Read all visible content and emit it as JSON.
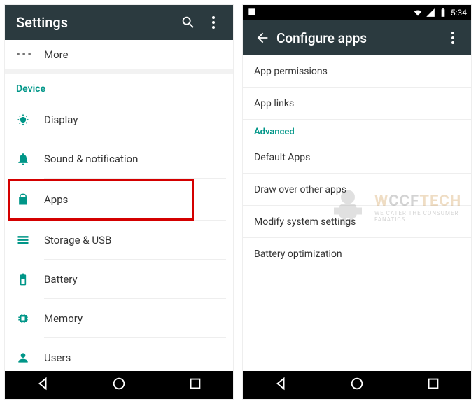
{
  "left": {
    "appbar": {
      "title": "Settings"
    },
    "more": {
      "label": "More"
    },
    "section": "Device",
    "rows": {
      "display": "Display",
      "sound": "Sound & notification",
      "apps": "Apps",
      "storage": "Storage & USB",
      "battery": "Battery",
      "memory": "Memory",
      "users": "Users"
    }
  },
  "right": {
    "status": {
      "time": "5:34"
    },
    "appbar": {
      "title": "Configure apps"
    },
    "rows": {
      "permissions": "App permissions",
      "links": "App links",
      "defaultapps": "Default Apps",
      "drawover": "Draw over other apps",
      "modsys": "Modify system settings",
      "battopt": "Battery optimization"
    },
    "section": "Advanced"
  },
  "watermark": {
    "brand_w": "W",
    "brand_ccf": "CCF",
    "brand_tech": "TECH",
    "sub": "WE CATER THE CONSUMER FANATICS"
  }
}
